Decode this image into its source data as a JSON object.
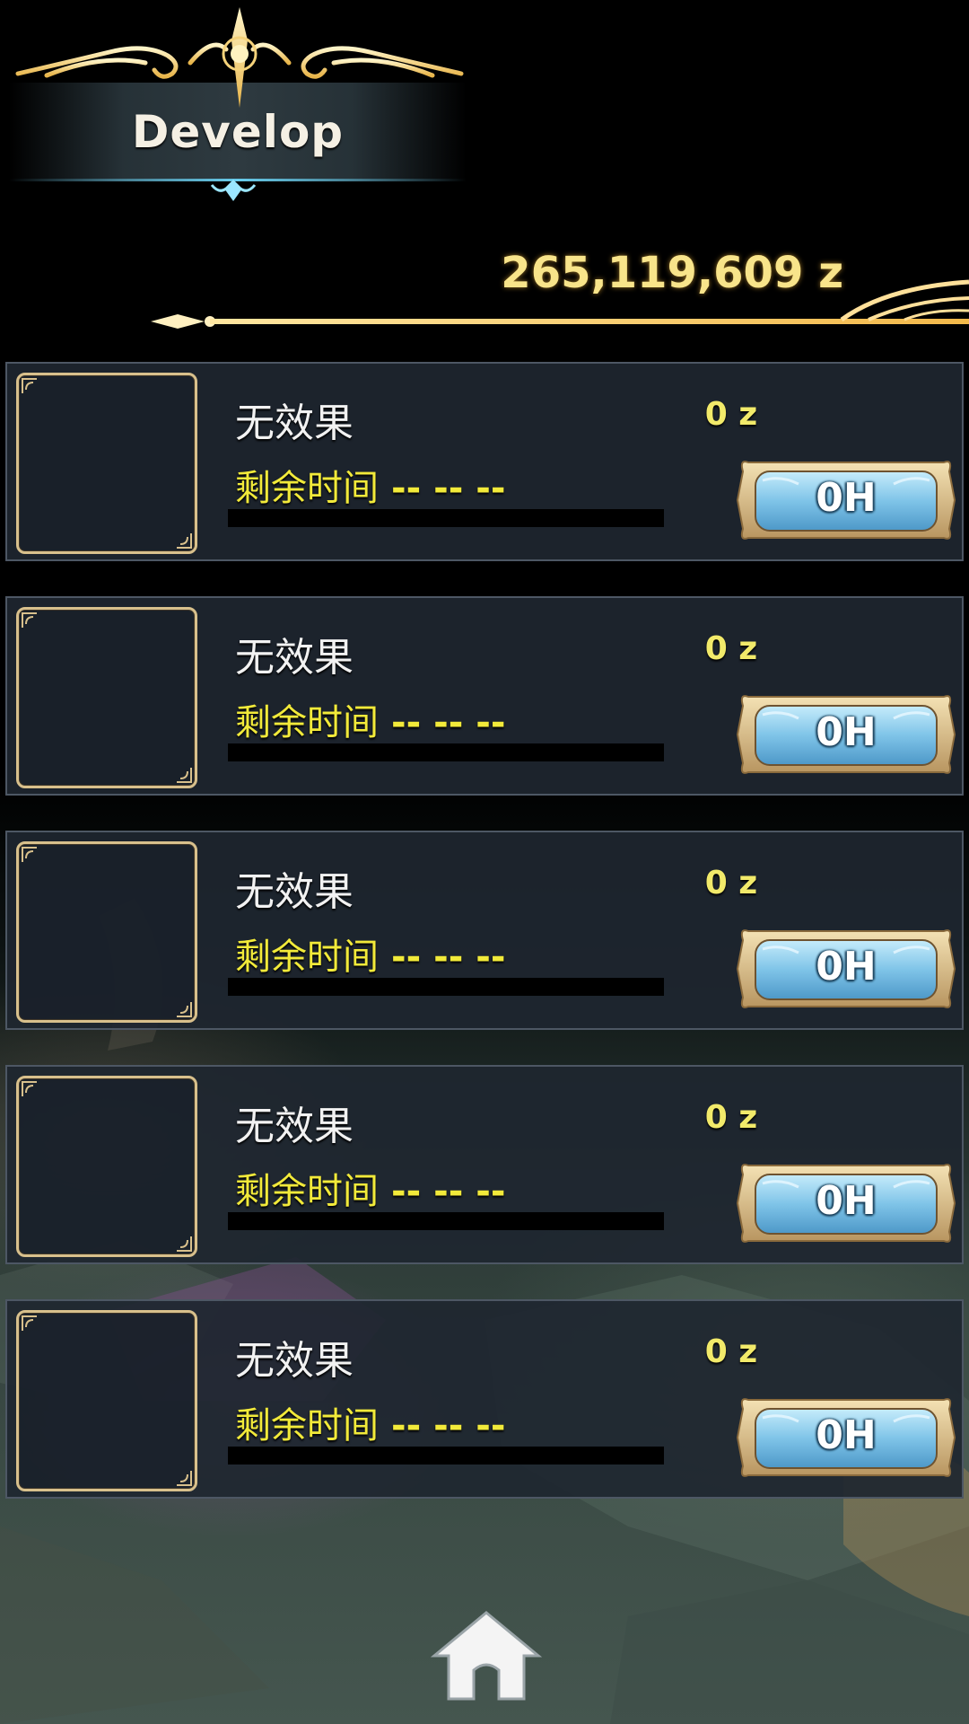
{
  "header": {
    "title": "Develop",
    "currency": "265,119,609 z"
  },
  "slots": [
    {
      "effect": "无效果",
      "time_label": "剩余时间",
      "time_value": "-- -- --",
      "cost": "0 z",
      "button_label": "0H",
      "progress": 0
    },
    {
      "effect": "无效果",
      "time_label": "剩余时间",
      "time_value": "-- -- --",
      "cost": "0 z",
      "button_label": "0H",
      "progress": 0
    },
    {
      "effect": "无效果",
      "time_label": "剩余时间",
      "time_value": "-- -- --",
      "cost": "0 z",
      "button_label": "0H",
      "progress": 0
    },
    {
      "effect": "无效果",
      "time_label": "剩余时间",
      "time_value": "-- -- --",
      "cost": "0 z",
      "button_label": "0H",
      "progress": 0
    },
    {
      "effect": "无效果",
      "time_label": "剩余时间",
      "time_value": "-- -- --",
      "cost": "0 z",
      "button_label": "0H",
      "progress": 0
    }
  ],
  "footer": {
    "home_icon": "home-icon"
  },
  "colors": {
    "gold": "#f8e48a",
    "time_yellow": "#f2ea3a",
    "row_bg": "#1e2630",
    "slot_border": "#d8c08c",
    "button_blue": "#7fc4e8"
  }
}
